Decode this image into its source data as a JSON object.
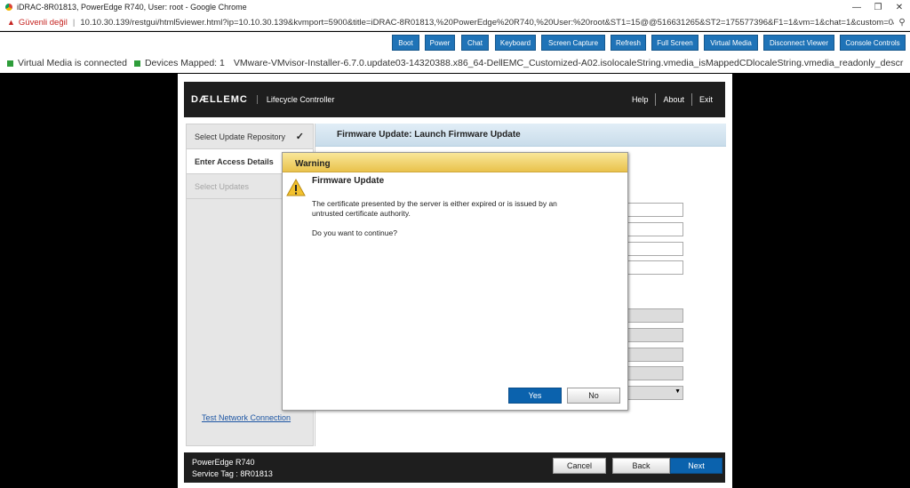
{
  "browser": {
    "window_title": "iDRAC-8R01813, PowerEdge R740, User: root - Google Chrome",
    "security_label": "Güvenli değil",
    "url": "10.10.30.139/restgui/html5viewer.html?ip=10.10.30.139&kvmport=5900&title=iDRAC-8R01813,%20PowerEdge%20R740,%20User:%20root&ST1=15@@516631265&ST2=175577396&F1=1&vm=1&chat=1&custom=0&..."
  },
  "toolbar": {
    "buttons": [
      "Boot",
      "Power",
      "Chat",
      "Keyboard",
      "Screen Capture",
      "Refresh",
      "Full Screen",
      "Virtual Media",
      "Disconnect Viewer",
      "Console Controls"
    ],
    "accent": "#1f73b7"
  },
  "status": {
    "virtual_media": "Virtual Media is connected",
    "devices_mapped": "Devices Mapped: 1",
    "image_name": "VMware-VMvisor-Installer-6.7.0.update03-14320388.x86_64-DellEMC_Customized-A02.isolocaleString.vmedia_isMappedCDlocaleString.vmedia_readonly_descr",
    "indicator_color": "#2e9d3a"
  },
  "lc": {
    "brand": "DÆLLEMC",
    "product": "Lifecycle Controller",
    "links": [
      "Help",
      "About",
      "Exit"
    ],
    "nav": [
      {
        "label": "Select Update Repository",
        "state": "done"
      },
      {
        "label": "Enter Access Details",
        "state": "active"
      },
      {
        "label": "Select Updates",
        "state": "disabled"
      }
    ],
    "page_title": "Firmware Update: Launch Firmware Update",
    "test_link": "Test Network Connection",
    "footer": {
      "model": "PowerEdge R740",
      "service_tag": "Service Tag : 8R01813",
      "cancel": "Cancel",
      "back": "Back",
      "next": "Next"
    }
  },
  "dialog": {
    "title": "Warning",
    "heading": "Firmware Update",
    "message": "The certificate presented by the server is either expired or is issued by an untrusted certificate authority.",
    "question": "Do you want to continue?",
    "yes": "Yes",
    "no": "No",
    "title_color": "#e9c24c"
  }
}
